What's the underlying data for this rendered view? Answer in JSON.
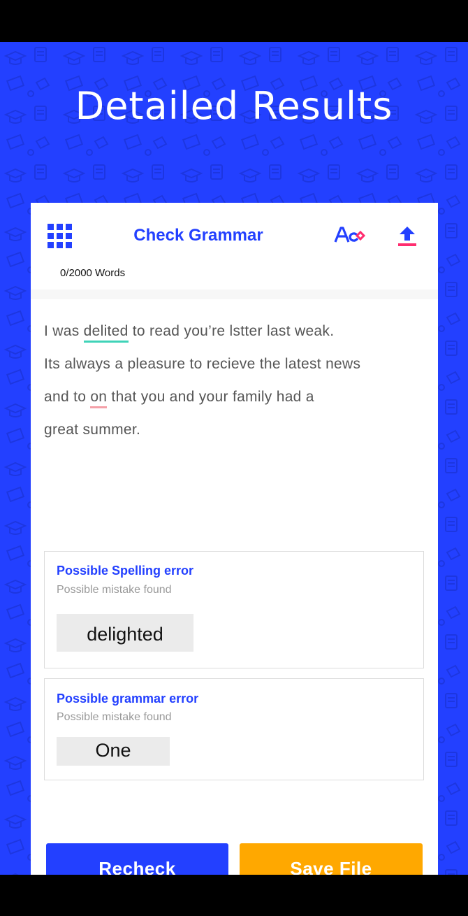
{
  "page": {
    "title": "Detailed Results"
  },
  "header": {
    "title": "Check Grammar",
    "word_count": "0/2000 Words",
    "menu_icon": "grid-menu-icon",
    "spell_icon": "spell-check-icon",
    "upload_icon": "upload-icon"
  },
  "document": {
    "line1": {
      "before": "I was ",
      "error": "delited",
      "after": " to read you’re lstter last weak."
    },
    "line2": "Its always a pleasure to recieve the latest news",
    "line3": {
      "before": "and to ",
      "error": "on",
      "after": " that you and your family had a"
    },
    "line4": "great summer."
  },
  "results": [
    {
      "title": "Possible Spelling error",
      "subtitle": "Possible mistake found",
      "suggestion": "delighted"
    },
    {
      "title": "Possible grammar error",
      "subtitle": "Possible mistake found",
      "suggestion": "One"
    }
  ],
  "actions": {
    "recheck": "Recheck",
    "save": "Save File"
  },
  "colors": {
    "brand_blue": "#2340ff",
    "save_orange": "#ffa800",
    "spell_underline": "#3fd3b8",
    "grammar_underline": "#f4a0a8",
    "accent_pink": "#ff2d6f"
  }
}
